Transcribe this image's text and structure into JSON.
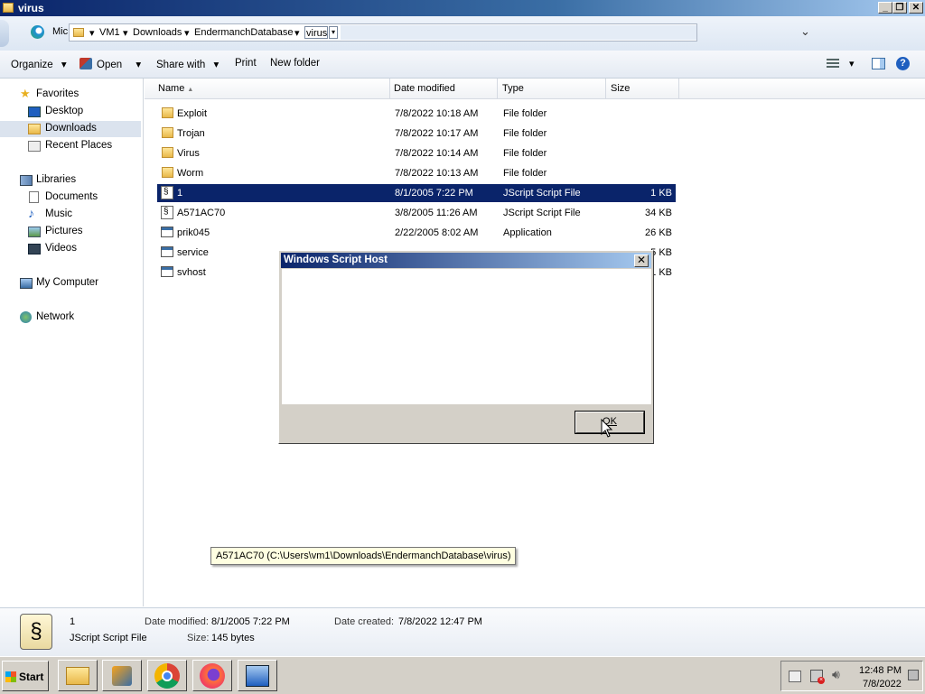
{
  "window": {
    "title": "virus"
  },
  "titlebar_buttons": {
    "min": "_",
    "max": "❐",
    "close": "✕"
  },
  "addressbar": {
    "partial_tab": "Mic",
    "crumbs": [
      "VM1",
      "Downloads",
      "EndermanchDatabase",
      "virus"
    ]
  },
  "toolbar": {
    "organize": "Organize",
    "open": "Open",
    "share_with": "Share with",
    "print": "Print",
    "new_folder": "New folder"
  },
  "nav": {
    "favorites": "Favorites",
    "desktop": "Desktop",
    "downloads": "Downloads",
    "recent_places": "Recent Places",
    "libraries": "Libraries",
    "documents": "Documents",
    "music": "Music",
    "pictures": "Pictures",
    "videos": "Videos",
    "my_computer": "My Computer",
    "network": "Network"
  },
  "columns": {
    "name": "Name",
    "date_modified": "Date modified",
    "type": "Type",
    "size": "Size"
  },
  "files": [
    {
      "name": "Exploit",
      "date": "7/8/2022 10:18 AM",
      "type": "File folder",
      "size": "",
      "kind": "folder"
    },
    {
      "name": "Trojan",
      "date": "7/8/2022 10:17 AM",
      "type": "File folder",
      "size": "",
      "kind": "folder"
    },
    {
      "name": "Virus",
      "date": "7/8/2022 10:14 AM",
      "type": "File folder",
      "size": "",
      "kind": "folder"
    },
    {
      "name": "Worm",
      "date": "7/8/2022 10:13 AM",
      "type": "File folder",
      "size": "",
      "kind": "folder"
    },
    {
      "name": "1",
      "date": "8/1/2005 7:22 PM",
      "type": "JScript Script File",
      "size": "1 KB",
      "kind": "script",
      "selected": true
    },
    {
      "name": "A571AC70",
      "date": "3/8/2005 11:26 AM",
      "type": "JScript Script File",
      "size": "34 KB",
      "kind": "script"
    },
    {
      "name": "prik045",
      "date": "2/22/2005 8:02 AM",
      "type": "Application",
      "size": "26 KB",
      "kind": "app"
    },
    {
      "name": "service",
      "date": "",
      "type": "",
      "size": "5 KB",
      "kind": "app"
    },
    {
      "name": "svhost",
      "date": "",
      "type": "",
      "size": "1 KB",
      "kind": "app"
    }
  ],
  "dialog": {
    "title": "Windows Script Host",
    "close": "✕",
    "ok": "OK"
  },
  "tooltip": {
    "text": "A571AC70 (C:\\Users\\vm1\\Downloads\\EndermanchDatabase\\virus)"
  },
  "details": {
    "name": "1",
    "type": "JScript Script File",
    "date_modified_label": "Date modified:",
    "date_modified": "8/1/2005 7:22 PM",
    "date_created_label": "Date created:",
    "date_created": "7/8/2022 12:47 PM",
    "size_label": "Size:",
    "size": "145 bytes"
  },
  "taskbar": {
    "start": "Start",
    "time": "12:48 PM",
    "date": "7/8/2022"
  }
}
